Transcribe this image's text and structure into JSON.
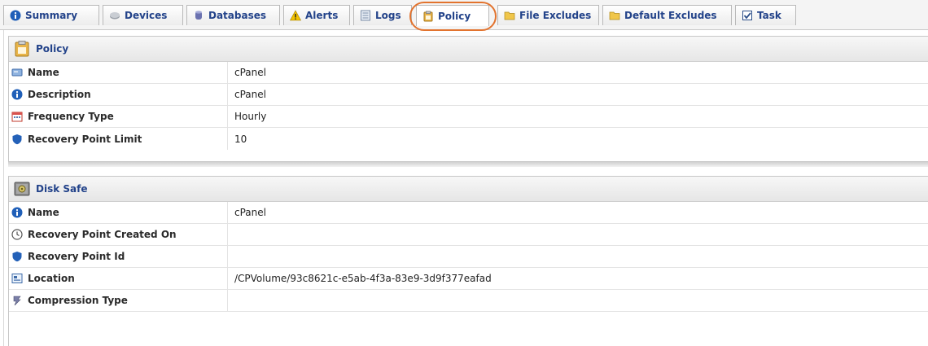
{
  "tabs": [
    {
      "label": "Summary",
      "icon": "info-icon"
    },
    {
      "label": "Devices",
      "icon": "devices-icon"
    },
    {
      "label": "Databases",
      "icon": "database-icon"
    },
    {
      "label": "Alerts",
      "icon": "warning-icon"
    },
    {
      "label": "Logs",
      "icon": "logs-icon"
    },
    {
      "label": "Policy",
      "icon": "policy-icon",
      "active": true
    },
    {
      "label": "File Excludes",
      "icon": "folder-icon"
    },
    {
      "label": "Default Excludes",
      "icon": "folder-icon"
    },
    {
      "label": "Task",
      "icon": "task-icon"
    }
  ],
  "policy": {
    "title": "Policy",
    "rows": [
      {
        "label": "Name",
        "value": "cPanel",
        "icon": "name-tag-icon"
      },
      {
        "label": "Description",
        "value": "cPanel",
        "icon": "info-icon"
      },
      {
        "label": "Frequency Type",
        "value": "Hourly",
        "icon": "calendar-icon"
      },
      {
        "label": "Recovery Point Limit",
        "value": "10",
        "icon": "shield-icon"
      }
    ]
  },
  "disksafe": {
    "title": "Disk Safe",
    "rows": [
      {
        "label": "Name",
        "value": "cPanel",
        "icon": "info-icon"
      },
      {
        "label": "Recovery Point Created On",
        "value": "",
        "icon": "clock-icon"
      },
      {
        "label": "Recovery Point Id",
        "value": "",
        "icon": "shield-icon"
      },
      {
        "label": "Location",
        "value": "/CPVolume/93c8621c-e5ab-4f3a-83e9-3d9f377eafad",
        "icon": "location-icon"
      },
      {
        "label": "Compression Type",
        "value": "",
        "icon": "compression-icon"
      }
    ]
  },
  "colors": {
    "tab_text": "#23438a",
    "highlight": "#e2732e"
  }
}
